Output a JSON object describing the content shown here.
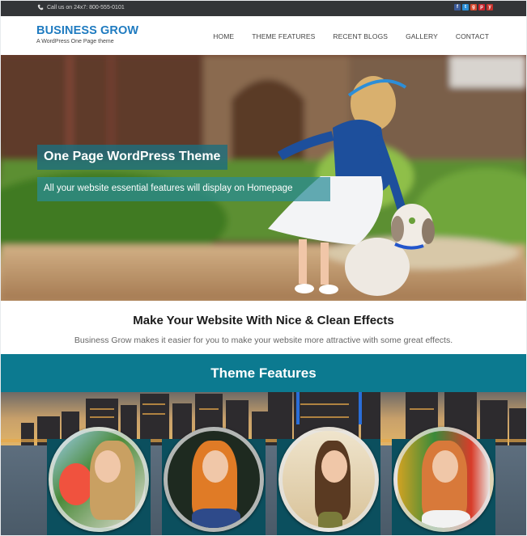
{
  "topbar": {
    "call_text": "Call us on  24x7: 800-555-0101",
    "social_icons": [
      {
        "name": "facebook-icon",
        "glyph": "f",
        "color": "#3b5998"
      },
      {
        "name": "twitter-icon",
        "glyph": "t",
        "color": "#2b8fd6"
      },
      {
        "name": "google-plus-icon",
        "glyph": "g",
        "color": "#d6492f"
      },
      {
        "name": "pinterest-icon",
        "glyph": "p",
        "color": "#c8232c"
      },
      {
        "name": "youtube-icon",
        "glyph": "y",
        "color": "#c4302b"
      }
    ]
  },
  "header": {
    "logo_title": "BUSINESS GROW",
    "logo_subtitle": "A WordPress One Page theme",
    "nav": [
      "HOME",
      "THEME FEATURES",
      "RECENT BLOGS",
      "GALLERY",
      "CONTACT"
    ]
  },
  "hero": {
    "title": "One Page WordPress Theme",
    "subtitle": "All your website essential features will display on Homepage"
  },
  "intro": {
    "heading": "Make Your Website With Nice & Clean Effects",
    "text": "Business Grow makes it easier for you to make your website more attractive with some great effects."
  },
  "features": {
    "heading": "Theme Features",
    "cards": 4
  },
  "colors": {
    "topbar": "#333538",
    "brand_blue": "#1f7bc0",
    "accent_teal": "#0c7a90",
    "card_teal": "#0b4f5e"
  }
}
